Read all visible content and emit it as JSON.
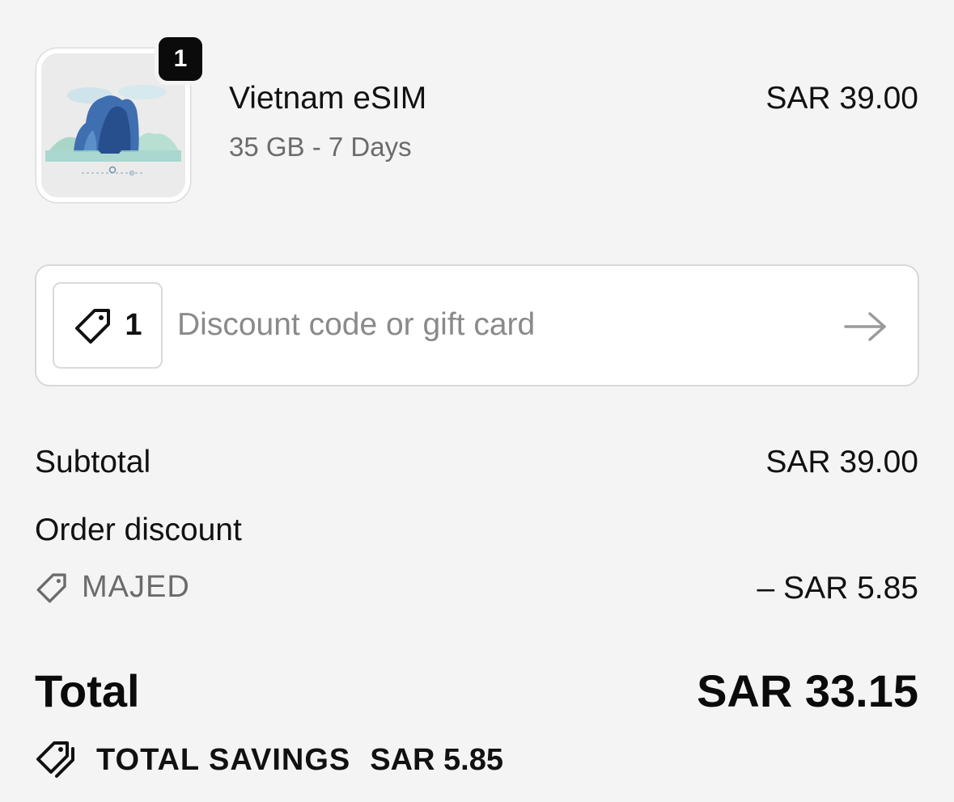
{
  "product": {
    "title": "Vietnam eSIM",
    "variant": "35 GB - 7 Days",
    "price": "SAR 39.00",
    "quantity": "1",
    "thumbnail_icon": "vietnam-landscape-thumbnail"
  },
  "discount": {
    "applied_count": "1",
    "placeholder": "Discount code or gift card",
    "value": "",
    "tag_icon": "tag-icon",
    "submit_icon": "arrow-right-icon"
  },
  "summary": {
    "subtotal_label": "Subtotal",
    "subtotal_value": "SAR 39.00",
    "order_discount_label": "Order discount",
    "discount_code": "MAJED",
    "discount_value": "– SAR 5.85",
    "total_label": "Total",
    "total_value": "SAR 33.15",
    "savings_label": "TOTAL SAVINGS",
    "savings_value": "SAR 5.85"
  },
  "colors": {
    "background": "#f4f4f4",
    "text": "#111111",
    "muted_text": "#6b6b6b",
    "placeholder": "#8a8a8a",
    "border": "#d8d8d8",
    "badge": "#0b0b0b"
  }
}
